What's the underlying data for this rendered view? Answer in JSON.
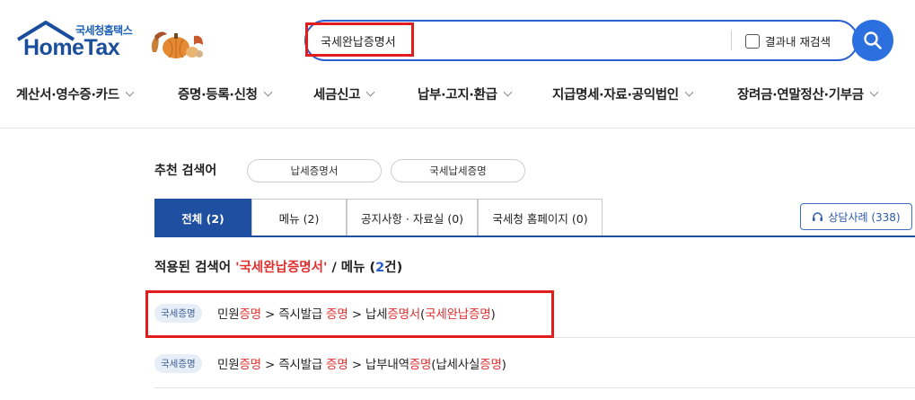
{
  "logo": {
    "korean": "국세청홈택스",
    "english": "HomeTax"
  },
  "search": {
    "query": "국세완납증명서",
    "research_label": "결과내 재검색",
    "button": "search"
  },
  "nav": {
    "items": [
      "계산서·영수증·카드",
      "증명·등록·신청",
      "세금신고",
      "납부·고지·환급",
      "지급명세·자료·공익법인",
      "장려금·연말정산·기부금"
    ]
  },
  "recommended": {
    "label": "추천 검색어",
    "chips": [
      "납세증명서",
      "국세납세증명"
    ]
  },
  "tabs": [
    "전체 (2)",
    "메뉴 (2)",
    "공지사항 · 자료실 (0)",
    "국세청 홈페이지 (0)"
  ],
  "counsel_button": "상담사례 (338)",
  "applied": {
    "prefix": "적용된 검색어 ",
    "keyword": "'국세완납증명서'",
    "middle": " / 메뉴 (",
    "count": "2",
    "suffix": "건)"
  },
  "results": [
    {
      "badge": "국세증명",
      "segments": [
        {
          "text": "민원",
          "hl": false
        },
        {
          "text": "증명",
          "hl": true
        },
        {
          "text": " > 즉시발급 ",
          "hl": false
        },
        {
          "text": "증명",
          "hl": true
        },
        {
          "text": " > 납세",
          "hl": false
        },
        {
          "text": "증명서",
          "hl": true
        },
        {
          "text": "(",
          "hl": false
        },
        {
          "text": "국세완납증명",
          "hl": true
        },
        {
          "text": ")",
          "hl": false
        }
      ]
    },
    {
      "badge": "국세증명",
      "segments": [
        {
          "text": "민원",
          "hl": false
        },
        {
          "text": "증명",
          "hl": true
        },
        {
          "text": " > 즉시발급 ",
          "hl": false
        },
        {
          "text": "증명",
          "hl": true
        },
        {
          "text": " > 납부내역",
          "hl": false
        },
        {
          "text": "증명",
          "hl": true
        },
        {
          "text": "(납세사실",
          "hl": false
        },
        {
          "text": "증명",
          "hl": true
        },
        {
          "text": ")",
          "hl": false
        }
      ]
    }
  ],
  "colors": {
    "brand_blue": "#1f4fa0",
    "search_border": "#2b5fd1",
    "highlight_red": "#e03030",
    "annotation_red": "#e11d1d"
  }
}
